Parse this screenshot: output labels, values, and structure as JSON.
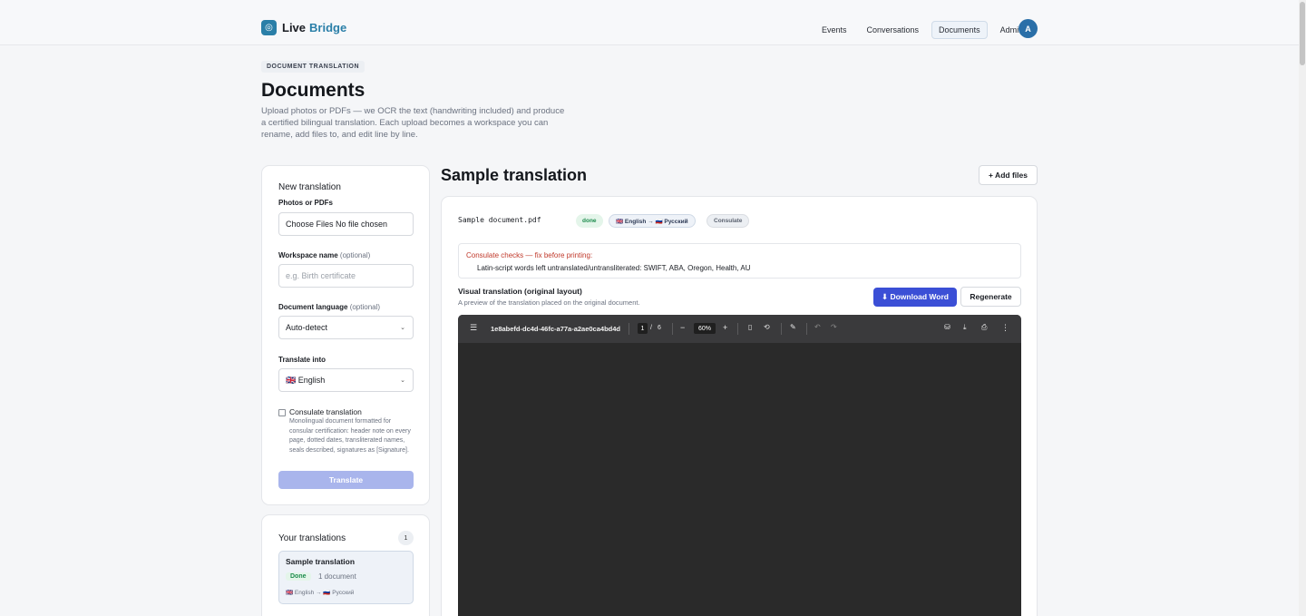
{
  "brand": {
    "logo_glyph": "◎",
    "name_a": "Live",
    "name_b": "Bridge",
    "accent": "#2a7fa8"
  },
  "nav": {
    "items": [
      "Events",
      "Conversations",
      "Documents",
      "Admin"
    ],
    "active": "Documents",
    "avatar_initial": "A"
  },
  "hero": {
    "eyebrow": "DOCUMENT TRANSLATION",
    "title": "Documents",
    "subtitle": "Upload photos or PDFs — we OCR the text (handwriting included) and produce a certified bilingual translation. Each upload becomes a workspace you can rename, add files to, and edit line by line."
  },
  "new_translation": {
    "title": "New translation",
    "files_label": "Photos or PDFs",
    "files_value": "Choose Files No file chosen",
    "workspace_label": "Workspace name",
    "optional_tag": "(optional)",
    "workspace_placeholder": "e.g. Birth certificate",
    "doc_lang_label": "Document language",
    "doc_lang_value": "Auto-detect",
    "translate_into_label": "Translate into",
    "translate_into_value": "🇬🇧 English",
    "consulate_label": "Consulate translation",
    "consulate_desc": "Monolingual document formatted for consular certification: header note on every page, dotted dates, transliterated names, seals described, signatures as [Signature].",
    "consulate_checked": false,
    "translate_button": "Translate"
  },
  "your_translations": {
    "title": "Your translations",
    "count": "1",
    "items": [
      {
        "name": "Sample translation",
        "status": "Done",
        "docs": "1 document",
        "langs": "🇬🇧 English → 🇷🇺 Русский"
      }
    ]
  },
  "workspace": {
    "title": "Sample translation",
    "add_files": "+ Add files",
    "document": {
      "filename": "Sample document.pdf",
      "status": "done",
      "langs": "🇬🇧 English → 🇷🇺 Русский",
      "mode": "Consulate"
    },
    "warning": {
      "title": "Consulate checks — fix before printing:",
      "text": "Latin-script words left untranslated/untransliterated: SWIFT, ABA, Oregon, Health, AU"
    },
    "visual": {
      "title": "Visual translation (original layout)",
      "subtitle": "A preview of the translation placed on the original document.",
      "download": "⬇ Download Word",
      "regenerate": "Regenerate"
    },
    "viewer": {
      "menu_icon": "☰",
      "doc_id": "1e8abefd-dc4d-46fc-a77a-a2ae0ca4bd4d",
      "page": "1",
      "page_sep": "/",
      "pages": "6",
      "zoom_out": "−",
      "zoom": "60%",
      "zoom_in": "+",
      "fit_icon": "▯",
      "rotate_icon": "⟲",
      "annotate_icon": "✎",
      "undo_icon": "↶",
      "redo_icon": "↷",
      "save_icon": "⛁",
      "download_icon": "⤓",
      "print_icon": "⎙",
      "more_icon": "⋮"
    }
  }
}
